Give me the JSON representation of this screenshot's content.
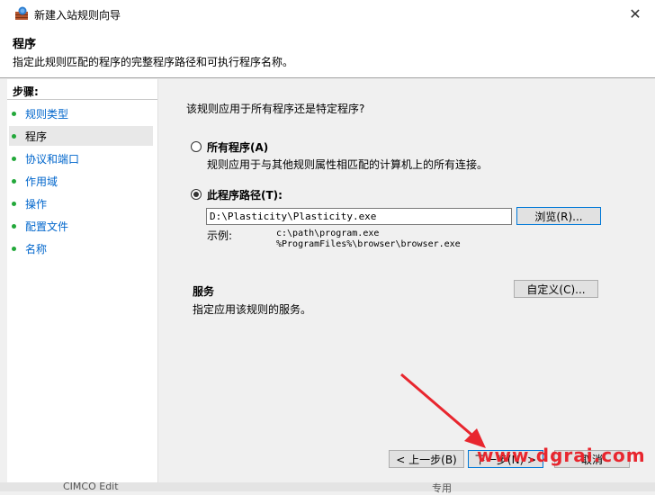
{
  "window": {
    "title": "新建入站规则向导",
    "close_glyph": "✕"
  },
  "header": {
    "title": "程序",
    "description": "指定此规则匹配的程序的完整程序路径和可执行程序名称。"
  },
  "steps": {
    "label": "步骤:",
    "items": [
      {
        "label": "规则类型"
      },
      {
        "label": "程序"
      },
      {
        "label": "协议和端口"
      },
      {
        "label": "作用域"
      },
      {
        "label": "操作"
      },
      {
        "label": "配置文件"
      },
      {
        "label": "名称"
      }
    ]
  },
  "main": {
    "question": "该规则应用于所有程序还是特定程序?",
    "all_programs": {
      "label": "所有程序(A)",
      "description": "规则应用于与其他规则属性相匹配的计算机上的所有连接。"
    },
    "this_program": {
      "label": "此程序路径(T):",
      "path_value": "D:\\Plasticity\\Plasticity.exe",
      "browse_label": "浏览(R)...",
      "example_label": "示例:",
      "example_line1": "c:\\path\\program.exe",
      "example_line2": "%ProgramFiles%\\browser\\browser.exe"
    },
    "services": {
      "title": "服务",
      "description": "指定应用该规则的服务。",
      "customize_label": "自定义(C)..."
    }
  },
  "footer": {
    "back_label": "< 上一步(B)",
    "next_label": "下一步(N) >",
    "cancel_label": "取消"
  },
  "behind": {
    "text_left": "CIMCO Edit",
    "text_right": "专用"
  },
  "watermark": "www.dgrai.com",
  "colors": {
    "accent": "#0078d7",
    "step_dot": "#22a83a",
    "link": "#0066cc",
    "watermark": "#e8262e",
    "arrow": "#e8262e"
  }
}
